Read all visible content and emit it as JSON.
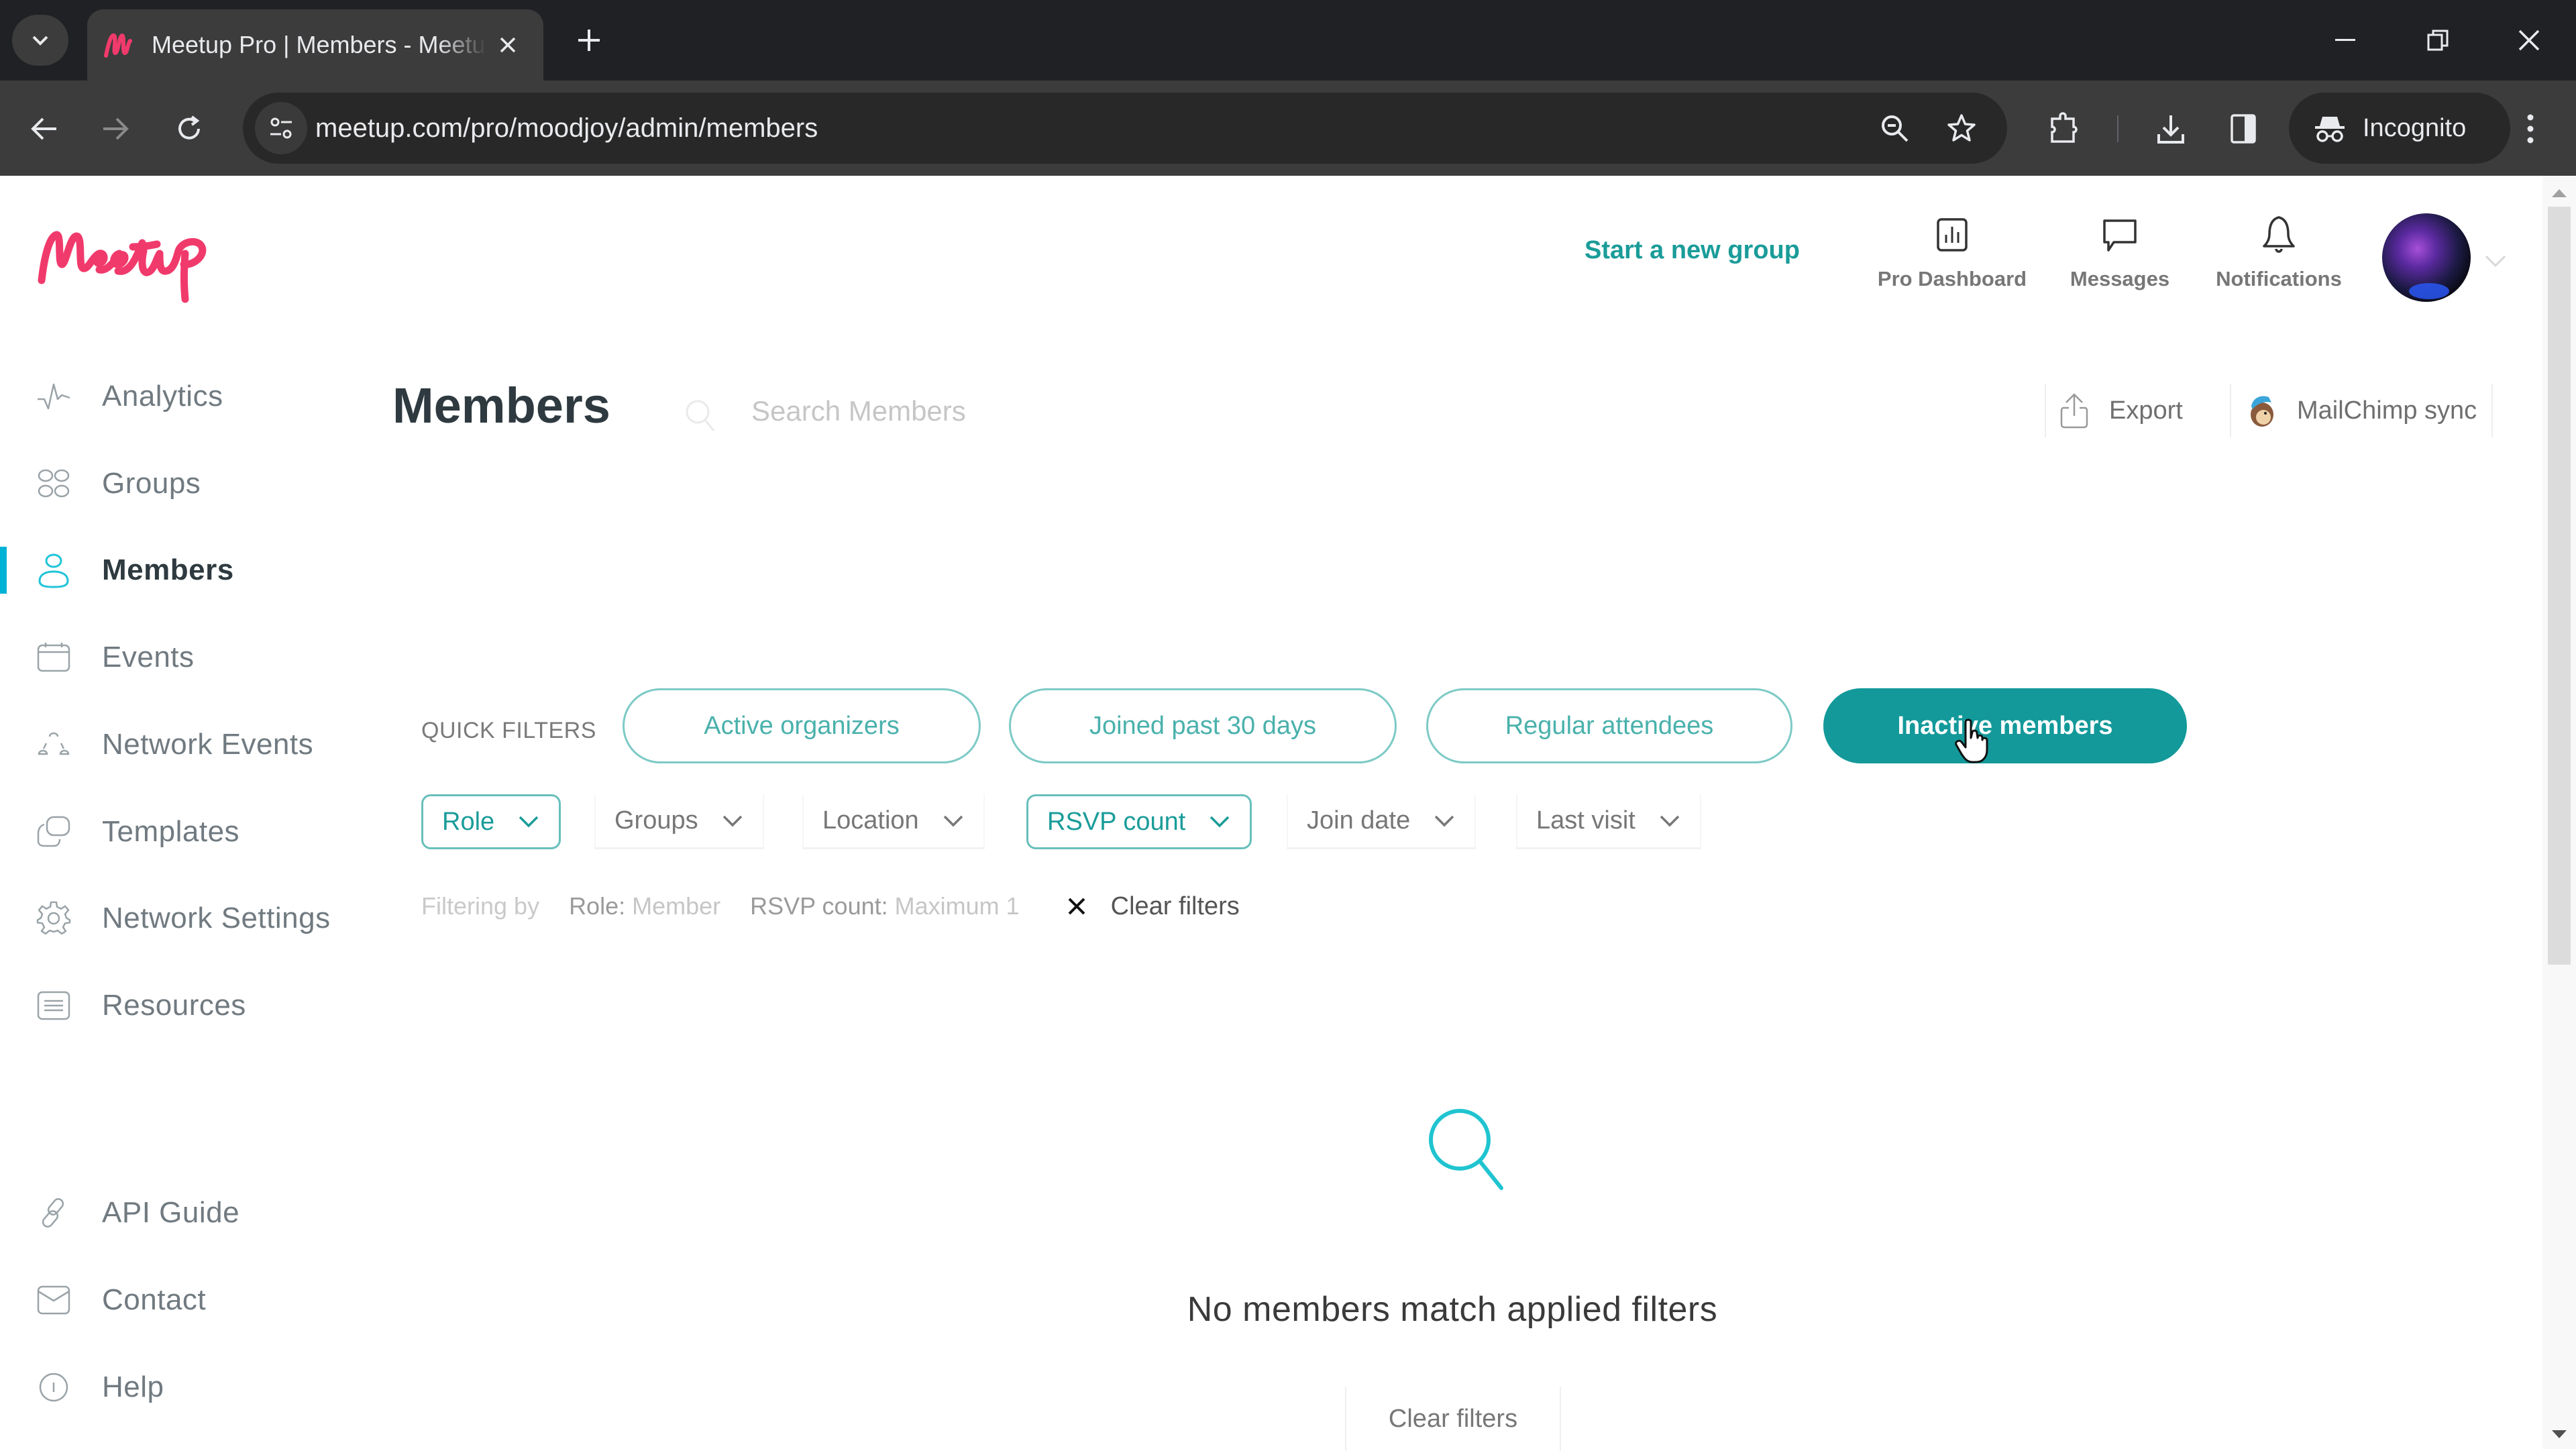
{
  "browser": {
    "tab_title": "Meetup Pro | Members - Meetup",
    "url": "meetup.com/pro/moodjoy/admin/members",
    "incognito_label": "Incognito"
  },
  "header": {
    "start_group": "Start a new group",
    "nav": [
      {
        "label": "Pro Dashboard",
        "icon": "bar-chart-icon"
      },
      {
        "label": "Messages",
        "icon": "chat-bubble-icon"
      },
      {
        "label": "Notifications",
        "icon": "bell-icon"
      }
    ]
  },
  "sidebar": {
    "items": [
      {
        "label": "Analytics",
        "icon": "pulse-icon"
      },
      {
        "label": "Groups",
        "icon": "groups-icon"
      },
      {
        "label": "Members",
        "icon": "person-icon",
        "active": true
      },
      {
        "label": "Events",
        "icon": "calendar-icon"
      },
      {
        "label": "Network Events",
        "icon": "network-icon"
      },
      {
        "label": "Templates",
        "icon": "templates-icon"
      },
      {
        "label": "Network Settings",
        "icon": "gear-icon"
      },
      {
        "label": "Resources",
        "icon": "document-icon"
      }
    ],
    "footer_items": [
      {
        "label": "API Guide",
        "icon": "link-icon"
      },
      {
        "label": "Contact",
        "icon": "mail-icon"
      },
      {
        "label": "Help",
        "icon": "info-icon"
      }
    ]
  },
  "main": {
    "title": "Members",
    "search_placeholder": "Search Members",
    "export_label": "Export",
    "mailchimp_label": "MailChimp sync",
    "quick_filters_label": "QUICK FILTERS",
    "quick_filters": [
      {
        "label": "Active organizers",
        "active": false
      },
      {
        "label": "Joined past 30 days",
        "active": false
      },
      {
        "label": "Regular attendees",
        "active": false
      },
      {
        "label": "Inactive members",
        "active": true
      }
    ],
    "dropdowns": [
      {
        "label": "Role",
        "applied": true
      },
      {
        "label": "Groups",
        "applied": false
      },
      {
        "label": "Location",
        "applied": false
      },
      {
        "label": "RSVP count",
        "applied": true
      },
      {
        "label": "Join date",
        "applied": false
      },
      {
        "label": "Last visit",
        "applied": false
      }
    ],
    "filtering_by_label": "Filtering by",
    "active_filters": [
      {
        "key": "Role:",
        "value": "Member"
      },
      {
        "key": "RSVP count:",
        "value": "Maximum 1"
      }
    ],
    "clear_filters_label": "Clear filters",
    "empty_state": {
      "message": "No members match applied filters",
      "button": "Clear filters"
    }
  },
  "colors": {
    "brand_pink": "#f13a6c",
    "teal": "#13999a",
    "teal_light": "#7dcac6",
    "cyan_accent": "#00b2d6"
  }
}
